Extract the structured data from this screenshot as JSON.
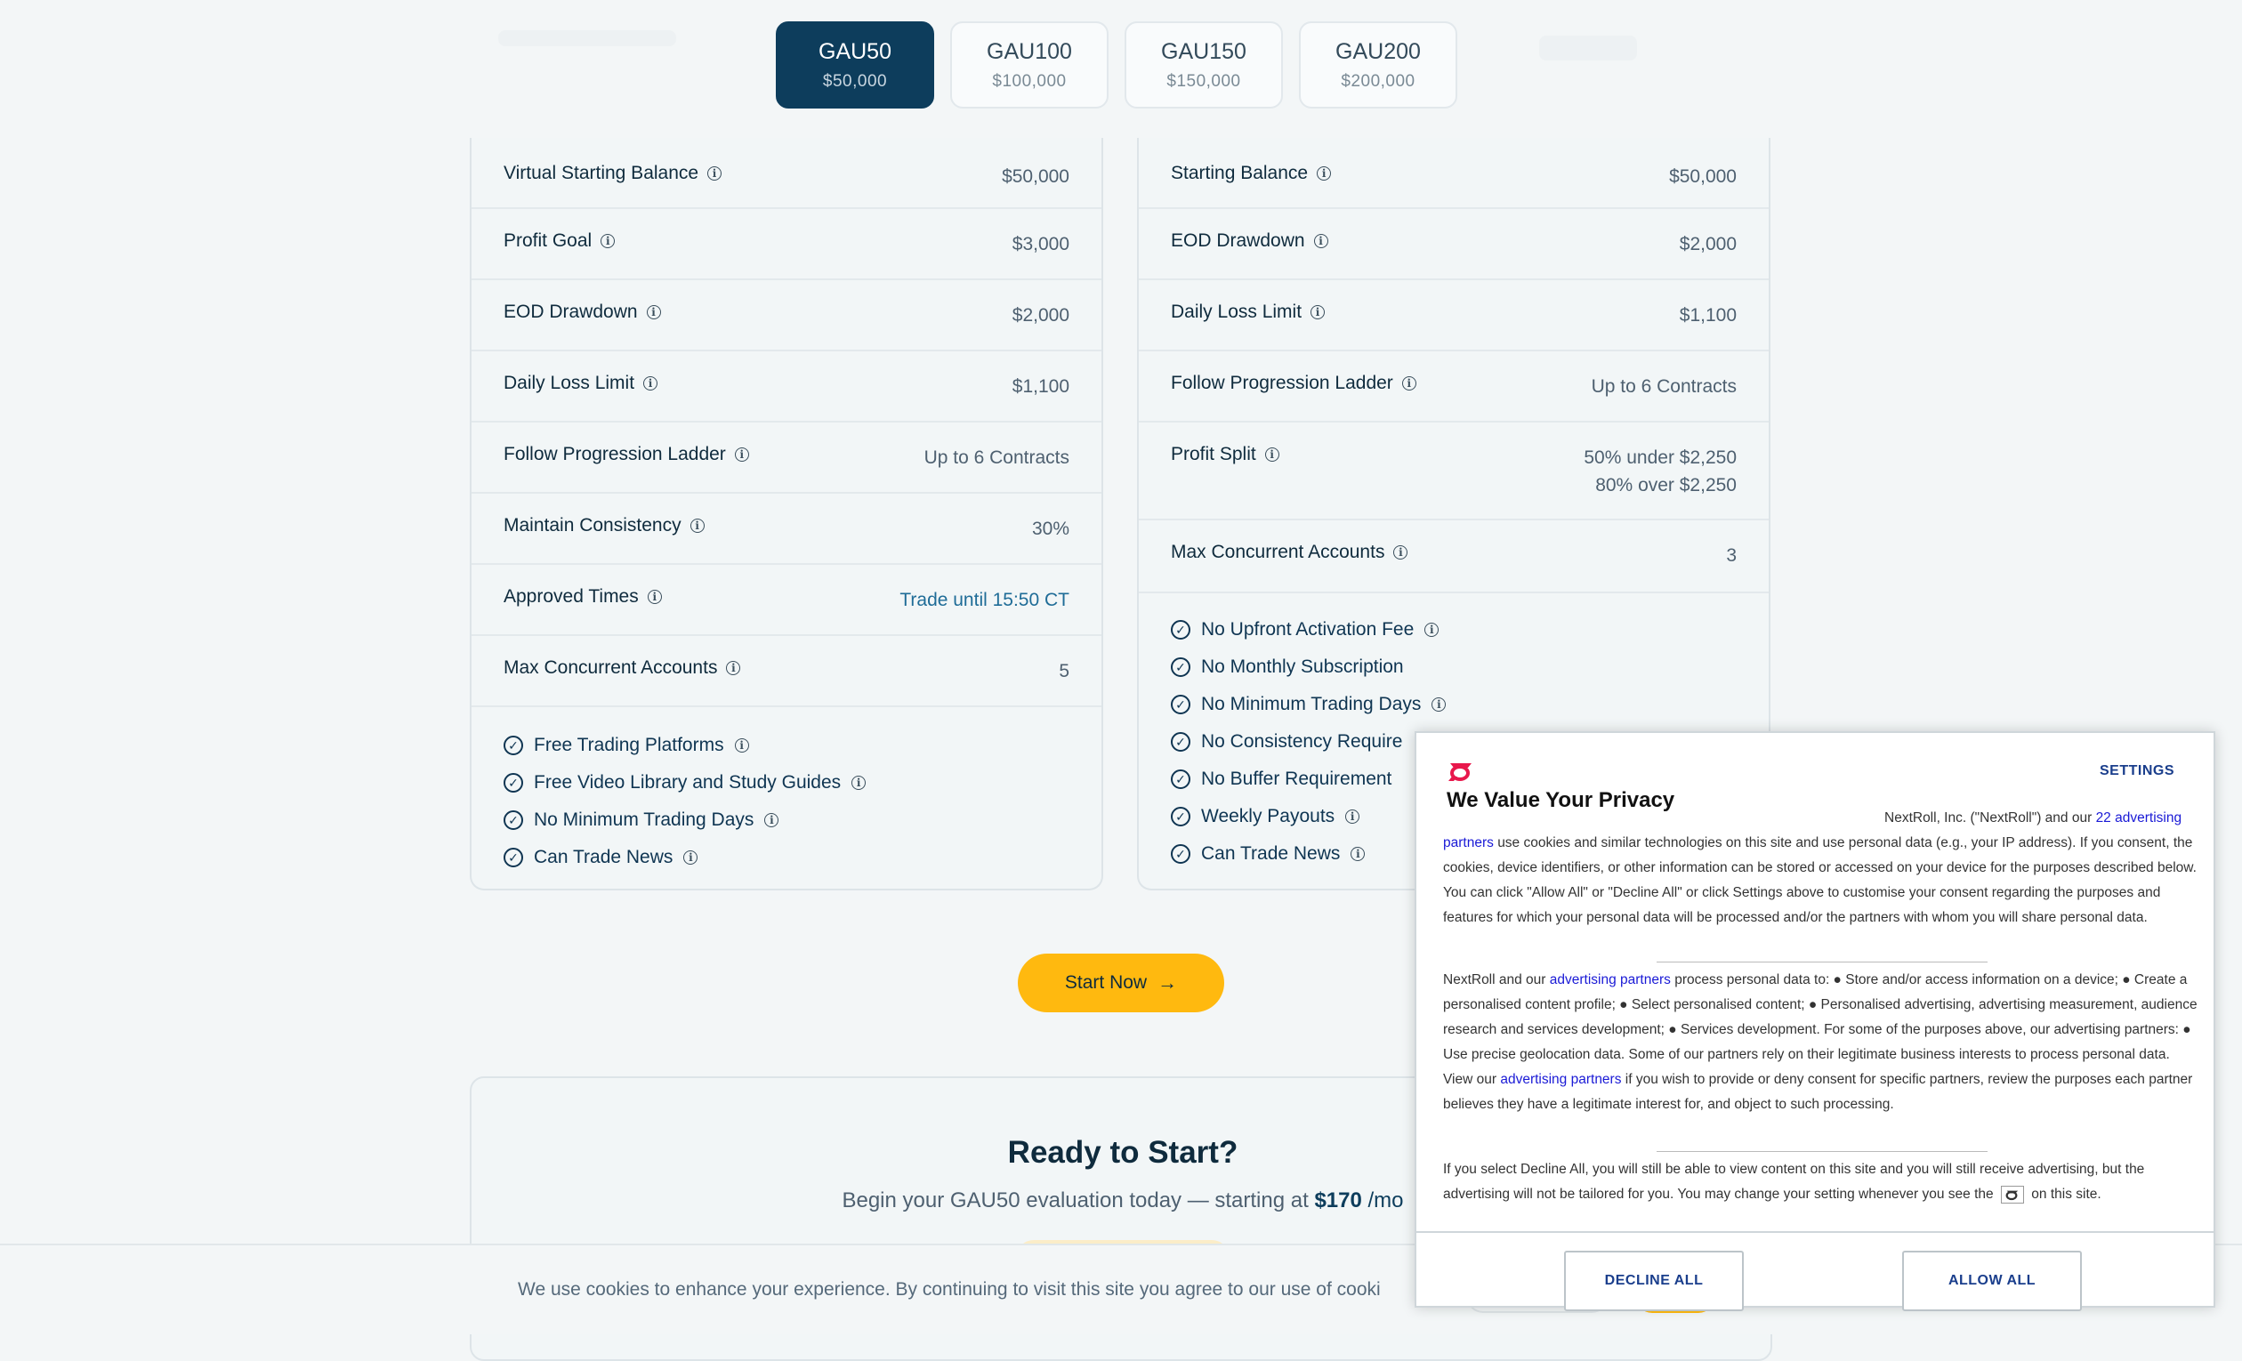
{
  "tabs": [
    {
      "name": "GAU50",
      "amount": "$50,000",
      "active": true
    },
    {
      "name": "GAU100",
      "amount": "$100,000",
      "active": false
    },
    {
      "name": "GAU150",
      "amount": "$150,000",
      "active": false
    },
    {
      "name": "GAU200",
      "amount": "$200,000",
      "active": false
    }
  ],
  "left_card": {
    "rows": [
      {
        "label": "Virtual Starting Balance",
        "value": "$50,000"
      },
      {
        "label": "Profit Goal",
        "value": "$3,000"
      },
      {
        "label": "EOD Drawdown",
        "value": "$2,000"
      },
      {
        "label": "Daily Loss Limit",
        "value": "$1,100"
      },
      {
        "label": "Follow Progression Ladder",
        "value": "Up to 6 Contracts"
      },
      {
        "label": "Maintain Consistency",
        "value": "30%"
      },
      {
        "label": "Approved Times",
        "value": "Trade until 15:50 CT"
      },
      {
        "label": "Max Concurrent Accounts",
        "value": "5"
      }
    ],
    "features": [
      "Free Trading Platforms",
      "Free Video Library and Study Guides",
      "No Minimum Trading Days",
      "Can Trade News"
    ]
  },
  "right_card": {
    "rows": [
      {
        "label": "Starting Balance",
        "value": "$50,000"
      },
      {
        "label": "EOD Drawdown",
        "value": "$2,000"
      },
      {
        "label": "Daily Loss Limit",
        "value": "$1,100"
      },
      {
        "label": "Follow Progression Ladder",
        "value": "Up to 6 Contracts"
      },
      {
        "label": "Profit Split",
        "value_line1": "50% under $2,250",
        "value_line2": "80% over $2,250"
      },
      {
        "label": "Max Concurrent Accounts",
        "value": "3"
      }
    ],
    "features": [
      "No Upfront Activation Fee",
      "No Monthly Subscription",
      "No Minimum Trading Days",
      "No Consistency Require",
      "No Buffer Requirement",
      "Weekly Payouts",
      "Can Trade News"
    ]
  },
  "start_button": {
    "label": "Start Now"
  },
  "ready": {
    "title": "Ready to Start?",
    "sub_prefix": "Begin your GAU50 evaluation today — starting at",
    "price": "$170",
    "suffix": "/mo"
  },
  "cookie_bar": {
    "text": "We use cookies to enhance your experience. By continuing to visit this site you agree to our use of cooki"
  },
  "privacy": {
    "settings": "SETTINGS",
    "title": "We Value Your Privacy",
    "p1_a": "NextRoll, Inc. (\"NextRoll\") and our",
    "p1_link1": "22 advertising partners",
    "p1_b": "use cookies and similar technologies on this site and use personal data (e.g., your IP address). If you consent, the cookies, device identifiers, or other information can be stored or accessed on your device for the purposes described below. You can click \"Allow All\" or \"Decline All\" or click Settings above to customise your consent regarding the purposes and features for which your personal data will be processed and/or the partners with whom you will share personal data.",
    "p2_a": "NextRoll and our",
    "p2_link1": "advertising partners",
    "p2_b": "process personal data to: ● Store and/or access information on a device; ● Create a personalised content profile; ● Select personalised content; ● Personalised advertising, advertising measurement, audience research and services development; ● Services development. For some of the purposes above, our advertising partners: ● Use precise geolocation data. Some of our partners rely on their legitimate business interests to process personal data. View our",
    "p2_link2": "advertising partners",
    "p2_c": "if you wish to provide or deny consent for specific partners, review the purposes each partner believes they have a legitimate interest for, and object to such processing.",
    "p3_a": "If you select Decline All, you will still be able to view content on this site and you will still receive advertising, but the advertising will not be tailored for you. You may change your setting whenever you see the",
    "p3_b": "on this site.",
    "decline": "DECLINE ALL",
    "allow": "ALLOW ALL"
  },
  "colors": {
    "accent_navy": "#0d3d5c",
    "cta_yellow": "#ffb90f",
    "link_blue": "#1f6c97",
    "nextroll_pink": "#e8184c"
  }
}
